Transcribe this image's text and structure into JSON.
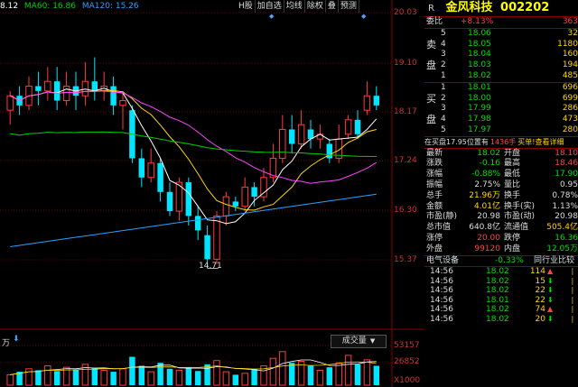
{
  "legend": {
    "ma_prefix": "8.12",
    "ma60": "MA60: 16.86",
    "ma120": "MA120: 15.26",
    "ma_prefix_color": "#ffffff",
    "ma60_color": "#00d000",
    "ma120_color": "#2aa0ff"
  },
  "toolbar": [
    "H股",
    "加自选",
    "均线",
    "除权",
    "叠",
    "预测"
  ],
  "price_axis": [
    "20.03",
    "19.10",
    "18.17",
    "17.24",
    "16.30",
    "15.37",
    "14.71"
  ],
  "volume_axis": [
    "53157",
    "26852",
    "X1000"
  ],
  "volume_unit": "万",
  "volume_tab": "成交量",
  "colors": {
    "up": "#ff3b3b",
    "down": "#00e5ff",
    "ma5": "#ffffff",
    "ma10": "#ffd700",
    "ma20": "#ff44ff",
    "ma60": "#00d000",
    "ma120": "#2aa0ff",
    "grid": "#8a0000"
  },
  "chart_data": {
    "type": "candlestick",
    "y_range": [
      14.7,
      20.03
    ],
    "low_label": "14.71",
    "candles": [
      [
        18.0,
        18.3,
        17.7,
        18.4,
        "up"
      ],
      [
        18.3,
        18.1,
        17.9,
        18.5,
        "down"
      ],
      [
        18.1,
        18.5,
        18.0,
        18.7,
        "up"
      ],
      [
        18.5,
        18.4,
        18.1,
        18.8,
        "down"
      ],
      [
        18.4,
        18.6,
        18.2,
        18.9,
        "up"
      ],
      [
        18.6,
        18.2,
        18.0,
        18.9,
        "down"
      ],
      [
        18.2,
        18.5,
        18.1,
        18.8,
        "up"
      ],
      [
        18.5,
        18.3,
        18.0,
        18.8,
        "down"
      ],
      [
        18.3,
        18.6,
        18.1,
        19.0,
        "up"
      ],
      [
        18.6,
        18.4,
        18.2,
        19.1,
        "down"
      ],
      [
        18.4,
        18.5,
        18.2,
        18.8,
        "up"
      ],
      [
        18.5,
        18.1,
        17.9,
        18.7,
        "down"
      ],
      [
        18.1,
        18.2,
        17.6,
        18.4,
        "up"
      ],
      [
        18.0,
        17.0,
        16.9,
        18.1,
        "down"
      ],
      [
        17.0,
        16.6,
        16.4,
        17.2,
        "down"
      ],
      [
        16.6,
        16.9,
        16.5,
        17.2,
        "up"
      ],
      [
        16.9,
        16.3,
        16.1,
        17.0,
        "down"
      ],
      [
        16.3,
        15.9,
        15.8,
        16.5,
        "down"
      ],
      [
        15.9,
        16.5,
        15.7,
        16.6,
        "up"
      ],
      [
        16.5,
        15.8,
        15.6,
        16.6,
        "down"
      ],
      [
        15.8,
        15.5,
        15.3,
        16.0,
        "down"
      ],
      [
        15.4,
        14.9,
        14.71,
        15.6,
        "down"
      ],
      [
        14.9,
        15.8,
        14.8,
        15.9,
        "up"
      ],
      [
        15.8,
        16.2,
        15.6,
        16.3,
        "up"
      ],
      [
        16.1,
        16.0,
        15.9,
        16.2,
        "down"
      ],
      [
        16.0,
        16.4,
        15.9,
        16.6,
        "up"
      ],
      [
        16.4,
        16.2,
        16.0,
        16.5,
        "down"
      ],
      [
        16.2,
        16.6,
        16.1,
        16.8,
        "up"
      ],
      [
        16.6,
        17.0,
        16.5,
        17.3,
        "up"
      ],
      [
        17.0,
        17.6,
        16.9,
        17.9,
        "up"
      ],
      [
        17.6,
        17.3,
        17.1,
        17.9,
        "down"
      ],
      [
        17.3,
        17.7,
        17.2,
        18.0,
        "up"
      ],
      [
        17.6,
        17.4,
        17.2,
        17.8,
        "down"
      ],
      [
        17.4,
        17.5,
        17.2,
        17.7,
        "up"
      ],
      [
        17.3,
        17.0,
        16.9,
        17.4,
        "down"
      ],
      [
        17.0,
        17.4,
        16.9,
        17.7,
        "up"
      ],
      [
        17.5,
        17.8,
        17.4,
        17.9,
        "up"
      ],
      [
        17.8,
        17.5,
        17.4,
        18.0,
        "down"
      ],
      [
        18.0,
        18.3,
        17.9,
        18.6,
        "up"
      ],
      [
        18.3,
        18.1,
        18.0,
        18.5,
        "down"
      ]
    ],
    "volume_max": 53157,
    "volumes": [
      [
        14000,
        "up"
      ],
      [
        18000,
        "down"
      ],
      [
        22000,
        "up"
      ],
      [
        20000,
        "down"
      ],
      [
        26000,
        "up"
      ],
      [
        19000,
        "down"
      ],
      [
        24000,
        "up"
      ],
      [
        21000,
        "down"
      ],
      [
        28000,
        "up"
      ],
      [
        23000,
        "down"
      ],
      [
        20000,
        "up"
      ],
      [
        18000,
        "down"
      ],
      [
        22000,
        "up"
      ],
      [
        38000,
        "down"
      ],
      [
        26000,
        "down"
      ],
      [
        18000,
        "up"
      ],
      [
        30000,
        "down"
      ],
      [
        22000,
        "down"
      ],
      [
        20000,
        "up"
      ],
      [
        24000,
        "down"
      ],
      [
        19000,
        "down"
      ],
      [
        28000,
        "down"
      ],
      [
        33000,
        "up"
      ],
      [
        18000,
        "up"
      ],
      [
        14000,
        "down"
      ],
      [
        16000,
        "up"
      ],
      [
        22000,
        "down"
      ],
      [
        26000,
        "up"
      ],
      [
        36000,
        "up"
      ],
      [
        45000,
        "up"
      ],
      [
        30000,
        "down"
      ],
      [
        32000,
        "up"
      ],
      [
        26000,
        "down"
      ],
      [
        20000,
        "up"
      ],
      [
        24000,
        "down"
      ],
      [
        30000,
        "up"
      ],
      [
        40000,
        "up"
      ],
      [
        28000,
        "down"
      ],
      [
        34000,
        "up"
      ],
      [
        26000,
        "down"
      ]
    ]
  },
  "quote": {
    "mark": "R",
    "name": "金风科技",
    "code": "002202",
    "weibi_label": "委比",
    "weibi_value": "+8.13%",
    "weibi_diff": "363",
    "sell_label": [
      "卖",
      "盘"
    ],
    "buy_label": [
      "买",
      "盘"
    ],
    "sells": [
      [
        "5",
        "18.06",
        "32"
      ],
      [
        "4",
        "18.05",
        "1180"
      ],
      [
        "3",
        "18.04",
        "160"
      ],
      [
        "2",
        "18.03",
        "194"
      ],
      [
        "1",
        "18.02",
        "485"
      ]
    ],
    "buys": [
      [
        "1",
        "18.01",
        "696"
      ],
      [
        "2",
        "18.00",
        "699"
      ],
      [
        "3",
        "17.99",
        "286"
      ],
      [
        "4",
        "17.98",
        "473"
      ],
      [
        "5",
        "17.97",
        "280"
      ]
    ],
    "notice_left": "在买盘17.95位置有",
    "notice_mid": "1436手",
    "notice_right": "买单!查看详细",
    "stats": [
      [
        "最新",
        "18.02",
        "开盘",
        "18.10"
      ],
      [
        "涨跌",
        "-0.16",
        "最高",
        "18.46"
      ],
      [
        "涨幅",
        "-0.88%",
        "最低",
        "17.90"
      ],
      [
        "振幅",
        "2.75%",
        "量比",
        "0.95"
      ],
      [
        "总手",
        "21.96万",
        "换手",
        "0.78%"
      ],
      [
        "金额",
        "4.01亿",
        "换手(实)",
        "1.13%"
      ],
      [
        "市盈(静)",
        "20.98",
        "市盈(动)",
        "20.98"
      ],
      [
        "总市值",
        "640.8亿",
        "流通值",
        "505.4亿"
      ],
      [
        "涨停",
        "20.00",
        "跌停",
        "16.36"
      ],
      [
        "外盘",
        "99120",
        "内盘",
        "12.05万"
      ]
    ],
    "sector": "电气设备",
    "sector_change": "-0.33%",
    "peer": "同行业比较",
    "ticks": [
      [
        "14:56",
        "18.02",
        "114",
        "up"
      ],
      [
        "14:56",
        "18.02",
        "15",
        "down"
      ],
      [
        "14:56",
        "18.02",
        "22",
        "down"
      ],
      [
        "14:56",
        "18.01",
        "22",
        "down"
      ],
      [
        "14:56",
        "18.02",
        "74",
        "up"
      ],
      [
        "14:56",
        "18.02",
        "20",
        "down"
      ]
    ]
  }
}
